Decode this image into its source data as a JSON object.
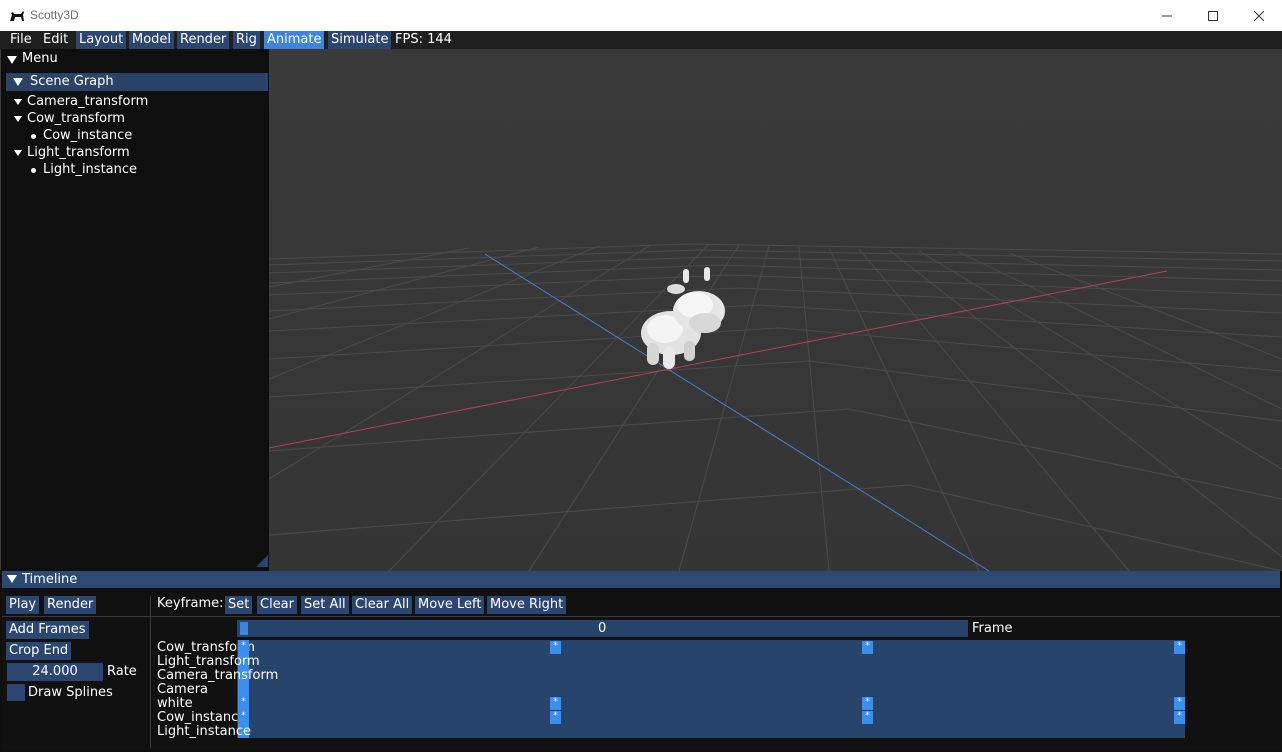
{
  "window": {
    "title": "Scotty3D",
    "controls": [
      "minimize",
      "maximize",
      "close"
    ]
  },
  "menubar": {
    "items": [
      {
        "label": "File",
        "style": "plain"
      },
      {
        "label": "Edit",
        "style": "plain"
      },
      {
        "label": "Layout",
        "style": "button"
      },
      {
        "label": "Model",
        "style": "button"
      },
      {
        "label": "Render",
        "style": "button"
      },
      {
        "label": "Rig",
        "style": "button"
      },
      {
        "label": "Animate",
        "style": "active"
      },
      {
        "label": "Simulate",
        "style": "button"
      }
    ],
    "fps": "FPS: 144"
  },
  "menu_panel": {
    "header": "Menu",
    "scene_graph_header": "Scene Graph",
    "nodes": [
      {
        "label": "Camera_transform",
        "kind": "expanded"
      },
      {
        "label": "Cow_transform",
        "kind": "expanded"
      },
      {
        "label": "Cow_instance",
        "kind": "leaf"
      },
      {
        "label": "Light_transform",
        "kind": "expanded"
      },
      {
        "label": "Light_instance",
        "kind": "leaf"
      }
    ]
  },
  "timeline": {
    "header": "Timeline",
    "play": "Play",
    "render": "Render",
    "keyframe_label": "Keyframe:",
    "keyframe_buttons": [
      "Set",
      "Clear",
      "Set All",
      "Clear All",
      "Move Left",
      "Move Right"
    ],
    "add_frames": "Add Frames",
    "crop_end": "Crop End",
    "rate_value": "24.000",
    "rate_label": "Rate",
    "draw_splines": "Draw Splines",
    "draw_splines_checked": false,
    "frame_value": "0",
    "frame_label": "Frame",
    "tracks": [
      "Cow_transform",
      "Light_transform",
      "Camera_transform",
      "Camera",
      "white",
      "Cow_instance",
      "Light_instance"
    ],
    "key_marker": "*"
  },
  "colors": {
    "accent": "#3d84dd",
    "button": "#2b4670",
    "viewport_bg": "#373737",
    "x_axis": "#b3424f",
    "z_axis": "#3f7fcf"
  }
}
